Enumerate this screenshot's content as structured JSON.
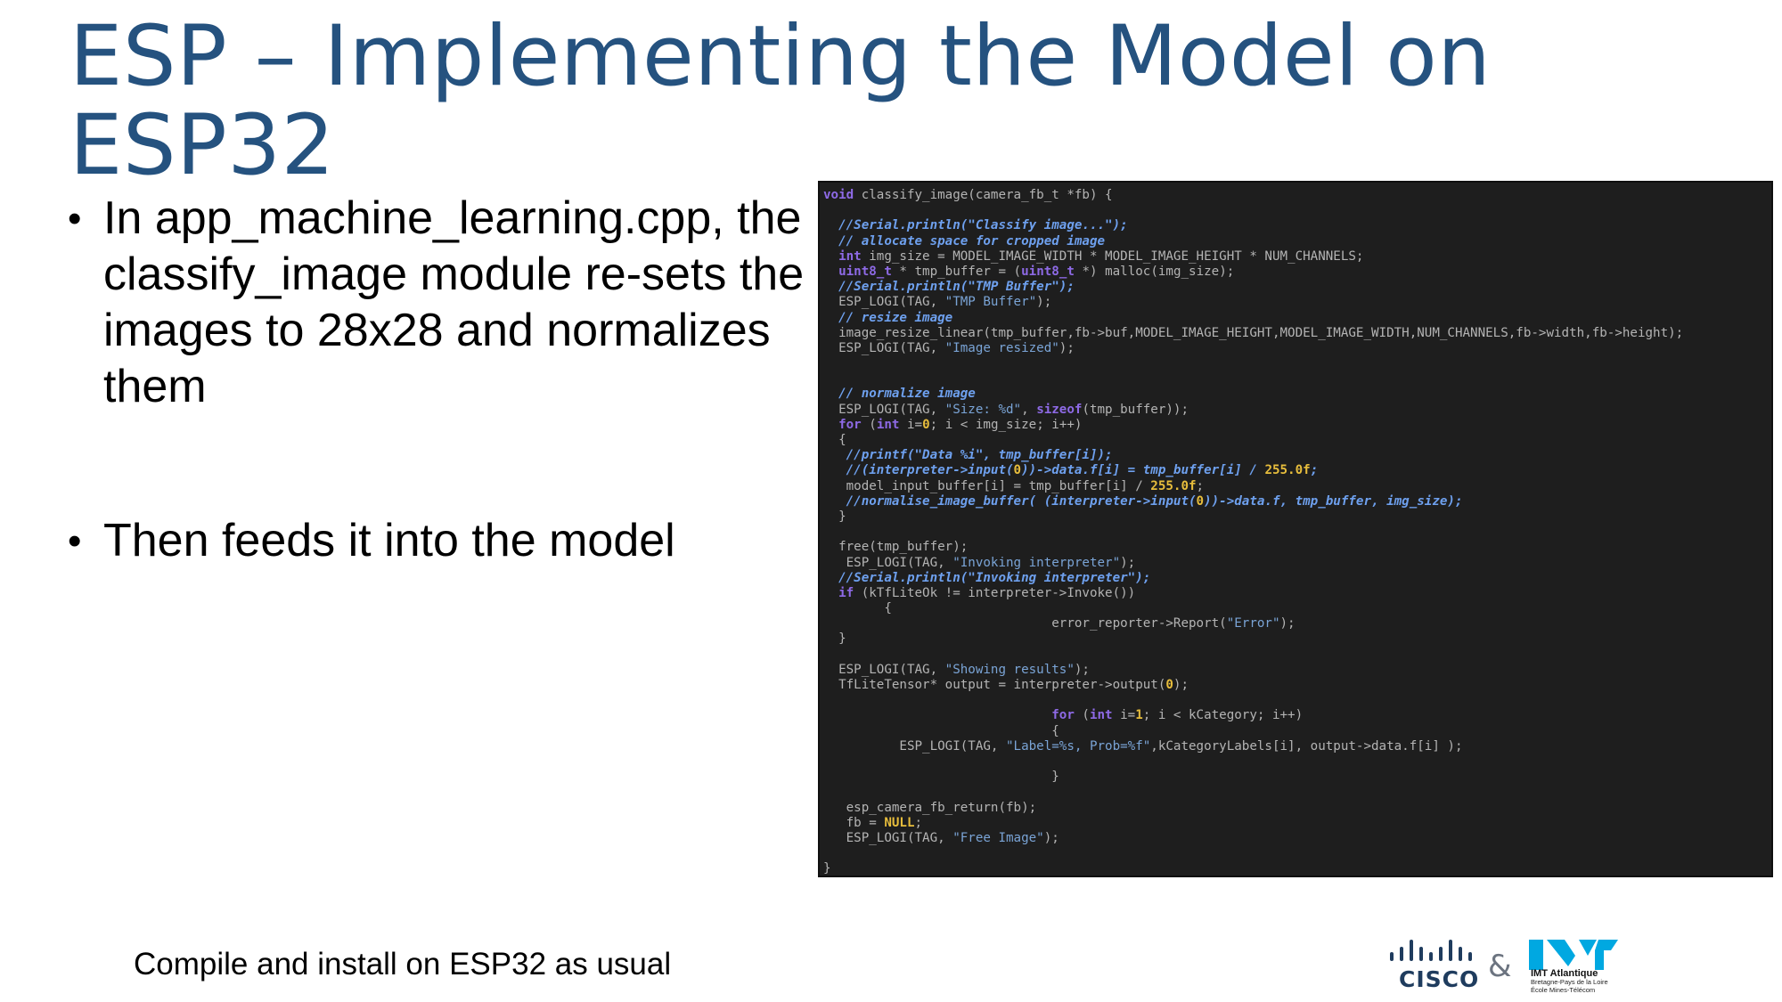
{
  "slide": {
    "title": "ESP – Implementing the Model on ESP32",
    "bullets": [
      "In app_machine_learning.cpp, the classify_image module re-sets the images to 28x28 and normalizes them",
      "Then feeds it into the model"
    ],
    "footnote": "Compile and install on ESP32 as usual"
  },
  "code": {
    "lines": [
      [
        [
          "kw",
          "void"
        ],
        [
          "pl",
          " classify_image(camera_fb_t *fb) {"
        ]
      ],
      [],
      [
        [
          "pl",
          "  "
        ],
        [
          "cm",
          "//Serial.println(\"Classify image...\");"
        ]
      ],
      [
        [
          "pl",
          "  "
        ],
        [
          "cm",
          "// allocate space for cropped image"
        ]
      ],
      [
        [
          "pl",
          "  "
        ],
        [
          "kw",
          "int"
        ],
        [
          "pl",
          " img_size = MODEL_IMAGE_WIDTH * MODEL_IMAGE_HEIGHT * NUM_CHANNELS;"
        ]
      ],
      [
        [
          "pl",
          "  "
        ],
        [
          "kw",
          "uint8_t"
        ],
        [
          "pl",
          " * tmp_buffer = ("
        ],
        [
          "kw",
          "uint8_t"
        ],
        [
          "pl",
          " *) malloc(img_size);"
        ]
      ],
      [
        [
          "pl",
          "  "
        ],
        [
          "cm",
          "//Serial.println(\"TMP Buffer\");"
        ]
      ],
      [
        [
          "pl",
          "  ESP_LOGI(TAG, "
        ],
        [
          "str",
          "\"TMP Buffer\""
        ],
        [
          "pl",
          ");"
        ]
      ],
      [
        [
          "pl",
          "  "
        ],
        [
          "cm",
          "// resize image"
        ]
      ],
      [
        [
          "pl",
          "  image_resize_linear(tmp_buffer,fb->buf,MODEL_IMAGE_HEIGHT,MODEL_IMAGE_WIDTH,NUM_CHANNELS,fb->width,fb->height);"
        ]
      ],
      [
        [
          "pl",
          "  ESP_LOGI(TAG, "
        ],
        [
          "str",
          "\"Image resized\""
        ],
        [
          "pl",
          ");"
        ]
      ],
      [],
      [],
      [
        [
          "pl",
          "  "
        ],
        [
          "cm",
          "// normalize image"
        ]
      ],
      [
        [
          "pl",
          "  ESP_LOGI(TAG, "
        ],
        [
          "str",
          "\"Size: %d\""
        ],
        [
          "pl",
          ", "
        ],
        [
          "kw",
          "sizeof"
        ],
        [
          "pl",
          "(tmp_buffer));"
        ]
      ],
      [
        [
          "pl",
          "  "
        ],
        [
          "kw",
          "for"
        ],
        [
          "pl",
          " ("
        ],
        [
          "kw",
          "int"
        ],
        [
          "pl",
          " i="
        ],
        [
          "num",
          "0"
        ],
        [
          "pl",
          "; i < img_size; i++)"
        ]
      ],
      [
        [
          "pl",
          "  {"
        ]
      ],
      [
        [
          "pl",
          "   "
        ],
        [
          "cm",
          "//printf(\"Data %i\", tmp_buffer[i]);"
        ]
      ],
      [
        [
          "pl",
          "   "
        ],
        [
          "cm",
          "//(interpreter->input("
        ],
        [
          "num",
          "0"
        ],
        [
          "cm",
          "))->data.f[i] = tmp_buffer[i] / "
        ],
        [
          "num",
          "255.0f"
        ],
        [
          "cm",
          ";"
        ]
      ],
      [
        [
          "pl",
          "   model_input_buffer[i] = tmp_buffer[i] / "
        ],
        [
          "num",
          "255.0f"
        ],
        [
          "pl",
          ";"
        ]
      ],
      [
        [
          "pl",
          "   "
        ],
        [
          "cm",
          "//normalise_image_buffer( (interpreter->input("
        ],
        [
          "num",
          "0"
        ],
        [
          "cm",
          "))->data.f, tmp_buffer, img_size);"
        ]
      ],
      [
        [
          "pl",
          "  }"
        ]
      ],
      [],
      [
        [
          "pl",
          "  free(tmp_buffer);"
        ]
      ],
      [
        [
          "pl",
          "   ESP_LOGI(TAG, "
        ],
        [
          "str",
          "\"Invoking interpreter\""
        ],
        [
          "pl",
          ");"
        ]
      ],
      [
        [
          "pl",
          "  "
        ],
        [
          "cm",
          "//Serial.println(\"Invoking interpreter\");"
        ]
      ],
      [
        [
          "pl",
          "  "
        ],
        [
          "kw",
          "if"
        ],
        [
          "pl",
          " (kTfLiteOk != interpreter->Invoke())"
        ]
      ],
      [
        [
          "pl",
          "        {"
        ]
      ],
      [
        [
          "pl",
          "                              error_reporter->Report("
        ],
        [
          "str",
          "\"Error\""
        ],
        [
          "pl",
          ");"
        ]
      ],
      [
        [
          "pl",
          "  }"
        ]
      ],
      [],
      [
        [
          "pl",
          "  ESP_LOGI(TAG, "
        ],
        [
          "str",
          "\"Showing results\""
        ],
        [
          "pl",
          ");"
        ]
      ],
      [
        [
          "pl",
          "  TfLiteTensor* output = interpreter->output("
        ],
        [
          "num",
          "0"
        ],
        [
          "pl",
          ");"
        ]
      ],
      [],
      [
        [
          "pl",
          "                              "
        ],
        [
          "kw",
          "for"
        ],
        [
          "pl",
          " ("
        ],
        [
          "kw",
          "int"
        ],
        [
          "pl",
          " i="
        ],
        [
          "num",
          "1"
        ],
        [
          "pl",
          "; i < kCategory; i++)"
        ]
      ],
      [
        [
          "pl",
          "                              {"
        ]
      ],
      [
        [
          "pl",
          "          ESP_LOGI(TAG, "
        ],
        [
          "str",
          "\"Label=%s, Prob=%f\""
        ],
        [
          "pl",
          ",kCategoryLabels[i], output->data.f[i] );"
        ]
      ],
      [],
      [
        [
          "pl",
          "                              }"
        ]
      ],
      [],
      [
        [
          "pl",
          "   esp_camera_fb_return(fb);"
        ]
      ],
      [
        [
          "pl",
          "   fb = "
        ],
        [
          "num",
          "NULL"
        ],
        [
          "pl",
          ";"
        ]
      ],
      [
        [
          "pl",
          "   ESP_LOGI(TAG, "
        ],
        [
          "str",
          "\"Free Image\""
        ],
        [
          "pl",
          ");"
        ]
      ],
      [],
      [
        [
          "pl",
          "}"
        ]
      ]
    ]
  },
  "logos": {
    "cisco": "CISCO",
    "separator": "&",
    "imt_name": "IMT Atlantique",
    "imt_sub": "Bretagne-Pays de la Loire\nÉcole Mines-Télécom",
    "cisco_color": "#1f3c5e",
    "imt_color": "#00a8e1"
  },
  "colors": {
    "title": "#25527f",
    "code_bg": "#1e1e1e",
    "code_keyword": "#8e6ae6",
    "code_comment": "#6ea0ee",
    "code_string": "#7aa4d6",
    "code_number": "#e7bd3c"
  }
}
